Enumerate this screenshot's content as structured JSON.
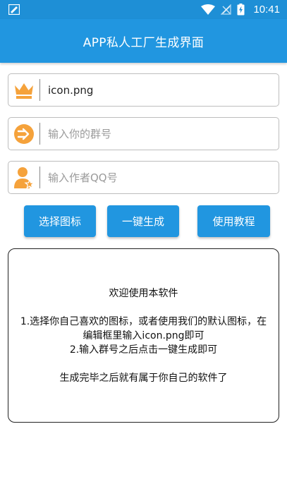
{
  "status_bar": {
    "time": "10:41",
    "icons": [
      "notification-icon",
      "wifi-icon",
      "signal-off-icon",
      "battery-charging-icon"
    ]
  },
  "app_bar": {
    "title": "APP私人工厂生成界面"
  },
  "form": {
    "icon_field": {
      "value": "icon.png",
      "icon": "crown-icon",
      "icon_color": "#f5a23b"
    },
    "group_field": {
      "placeholder": "输入你的群号",
      "icon": "share-arrow-icon",
      "icon_color": "#f5a23b"
    },
    "author_field": {
      "placeholder": "输入作者QQ号",
      "icon": "user-star-icon",
      "icon_color": "#f5a23b"
    }
  },
  "buttons": {
    "select_icon": "选择图标",
    "one_click_generate": "一键生成",
    "tutorial": "使用教程"
  },
  "info": {
    "line1": "欢迎使用本软件",
    "line2": "1.选择你自己喜欢的图标，或者使用我们的默认图标，在编辑框里输入icon.png即可",
    "line3": "2.输入群号之后点击一键生成即可",
    "line4": "生成完毕之后就有属于你自己的软件了"
  },
  "colors": {
    "primary": "#2196e0",
    "status_bar": "#1e8fd6",
    "accent": "#f5a23b"
  }
}
